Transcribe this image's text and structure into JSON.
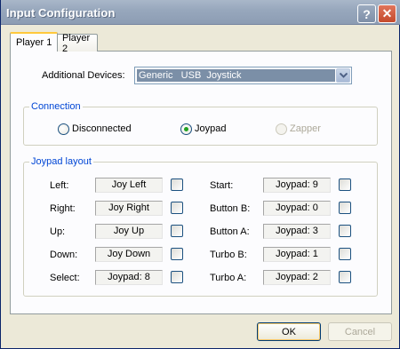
{
  "window": {
    "title": "Input Configuration",
    "help_glyph": "?",
    "close_glyph": "✕"
  },
  "tabs": [
    {
      "label": "Player 1",
      "selected": true
    },
    {
      "label": "Player 2",
      "selected": false
    }
  ],
  "devices": {
    "label": "Additional Devices:",
    "selected": "Generic   USB  Joystick"
  },
  "connection": {
    "title": "Connection",
    "options": [
      {
        "label": "Disconnected",
        "checked": false,
        "enabled": true
      },
      {
        "label": "Joypad",
        "checked": true,
        "enabled": true
      },
      {
        "label": "Zapper",
        "checked": false,
        "enabled": false
      }
    ]
  },
  "joypad": {
    "title": "Joypad layout",
    "left_column": [
      {
        "label": "Left:",
        "binding": "Joy Left"
      },
      {
        "label": "Right:",
        "binding": "Joy Right"
      },
      {
        "label": "Up:",
        "binding": "Joy Up"
      },
      {
        "label": "Down:",
        "binding": "Joy Down"
      },
      {
        "label": "Select:",
        "binding": "Joypad: 8"
      }
    ],
    "right_column": [
      {
        "label": "Start:",
        "binding": "Joypad: 9"
      },
      {
        "label": "Button B:",
        "binding": "Joypad: 0"
      },
      {
        "label": "Button A:",
        "binding": "Joypad: 3"
      },
      {
        "label": "Turbo B:",
        "binding": "Joypad: 1"
      },
      {
        "label": "Turbo A:",
        "binding": "Joypad: 2"
      }
    ]
  },
  "buttons": {
    "ok": "OK",
    "cancel": "Cancel"
  },
  "colors": {
    "titlebar": "#98a8bd",
    "group_title": "#0046d5",
    "selected_device": "#7b8fa7"
  }
}
